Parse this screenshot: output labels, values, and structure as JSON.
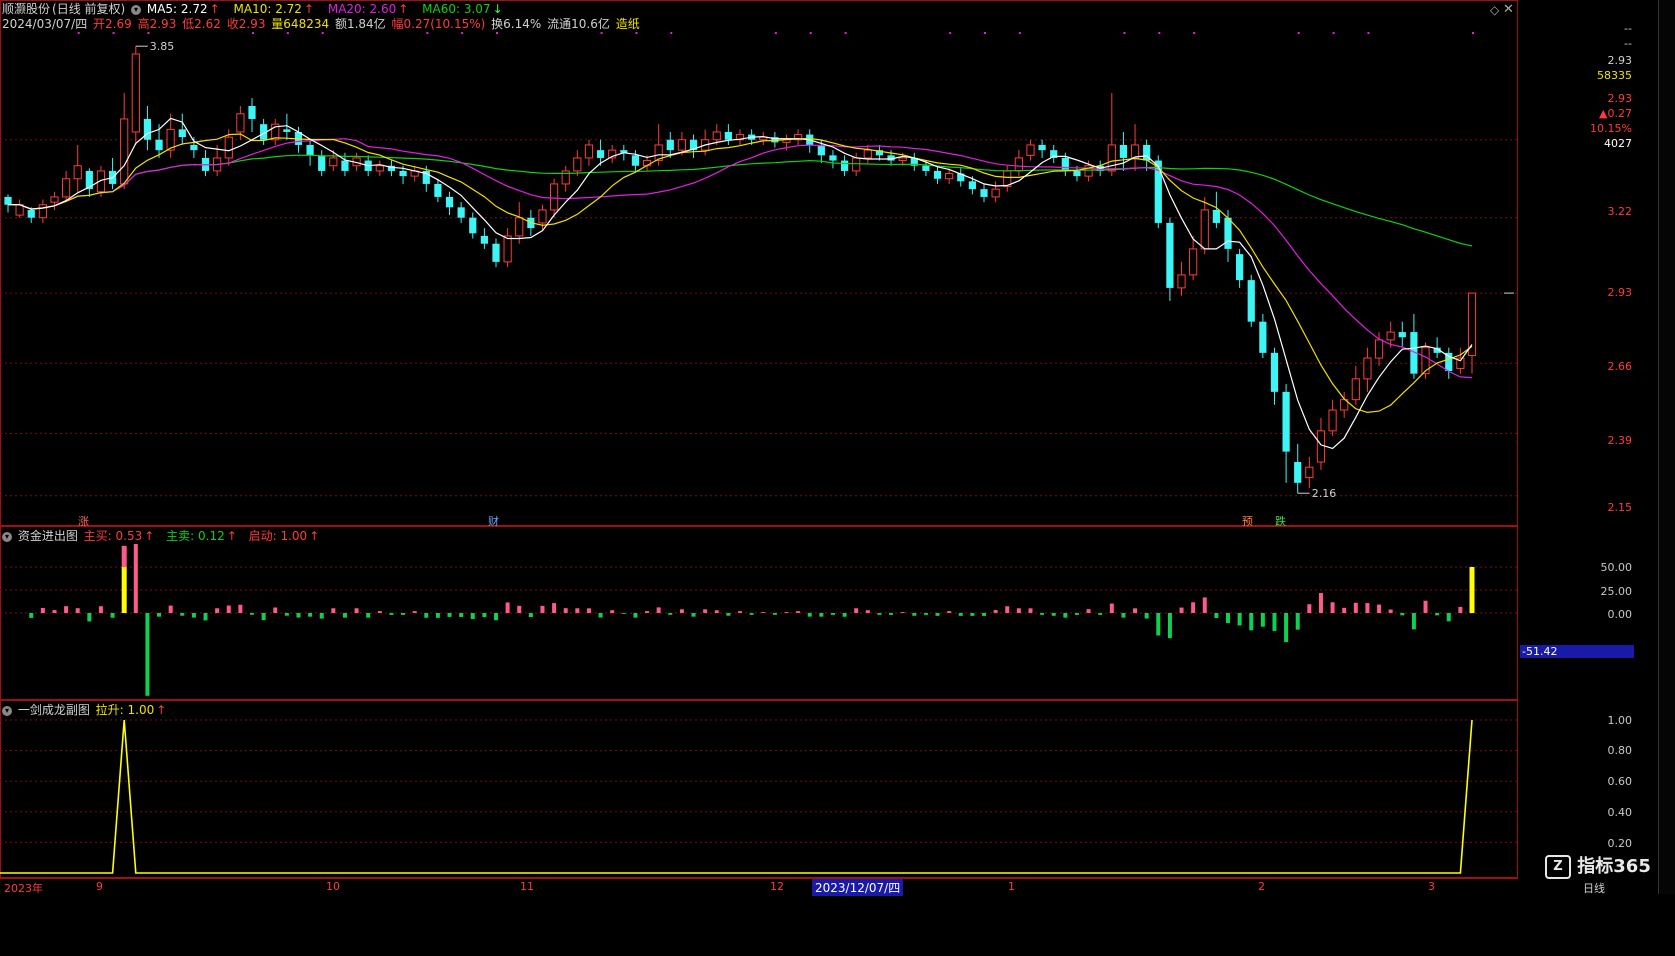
{
  "stock": {
    "name": "顺灏股份",
    "mode": "(日线 前复权)",
    "date": "2024/03/07/四",
    "ma5": "MA5: 2.72",
    "ma10": "MA10: 2.72",
    "ma20": "MA20: 2.60",
    "ma60": "MA60: 3.07",
    "open": "开2.69",
    "high": "高2.93",
    "low": "低2.62",
    "close": "收2.93",
    "volume": "量648234",
    "amount": "额1.84亿",
    "change": "幅0.27(10.15%)",
    "turnover": "换6.14%",
    "float": "流通10.6亿",
    "concept": "造纸",
    "max_label": "3.85",
    "min_label": "2.16"
  },
  "colors": {
    "up": "#ff3b3b",
    "down": "#3df5f5",
    "ma5": "#ffffff",
    "ma10": "#f0e000",
    "ma20": "#e020e0",
    "ma60": "#10d010",
    "grid": "#7a0f0f"
  },
  "right_axis": {
    "top_dash1": "--",
    "top_dash2": "--",
    "price": "2.93",
    "vol": "58335",
    "price2": "2.93",
    "chg": "▲0.27",
    "pct": "10.15%",
    "num": "4027",
    "ticks": [
      "3.22",
      "2.93",
      "2.66",
      "2.39",
      "2.15"
    ],
    "macd_ticks": [
      "50.00",
      "25.00",
      "0.00"
    ],
    "macd_value": "-51.42",
    "sub_ticks": [
      "1.00",
      "0.80",
      "0.60",
      "0.40",
      "0.20"
    ]
  },
  "markers": {
    "zhang": "涨",
    "cai": "财",
    "yu": "预",
    "die": "跌"
  },
  "panel2": {
    "title": "资金进出图",
    "buy": "主买: 0.53",
    "sell": "主卖: 0.12",
    "start": "启动: 1.00"
  },
  "panel3": {
    "title": "一剑成龙副图",
    "rise": "拉升: 1.00"
  },
  "time_axis": {
    "labels": [
      "2023年",
      "9",
      "10",
      "11",
      "12",
      "1",
      "2",
      "3"
    ],
    "cursor_date": "2023/12/07/四"
  },
  "brand": {
    "logo": "指标365",
    "period": "日线"
  },
  "chart_data": {
    "type": "candlestick",
    "ylim": [
      2.08,
      3.95
    ],
    "candles": [
      [
        3.3,
        3.27,
        3.31,
        3.24
      ],
      [
        3.23,
        3.27,
        3.29,
        3.22
      ],
      [
        3.25,
        3.22,
        3.26,
        3.2
      ],
      [
        3.22,
        3.27,
        3.29,
        3.2
      ],
      [
        3.28,
        3.3,
        3.32,
        3.25
      ],
      [
        3.3,
        3.37,
        3.4,
        3.28
      ],
      [
        3.37,
        3.42,
        3.5,
        3.32
      ],
      [
        3.4,
        3.33,
        3.41,
        3.3
      ],
      [
        3.32,
        3.4,
        3.42,
        3.3
      ],
      [
        3.4,
        3.35,
        3.45,
        3.33
      ],
      [
        3.35,
        3.6,
        3.7,
        3.33
      ],
      [
        3.55,
        3.85,
        3.88,
        3.5
      ],
      [
        3.6,
        3.52,
        3.65,
        3.48
      ],
      [
        3.52,
        3.48,
        3.58,
        3.45
      ],
      [
        3.48,
        3.56,
        3.62,
        3.45
      ],
      [
        3.56,
        3.53,
        3.62,
        3.5
      ],
      [
        3.5,
        3.48,
        3.53,
        3.45
      ],
      [
        3.45,
        3.4,
        3.48,
        3.38
      ],
      [
        3.4,
        3.45,
        3.5,
        3.38
      ],
      [
        3.45,
        3.53,
        3.56,
        3.42
      ],
      [
        3.55,
        3.62,
        3.65,
        3.52
      ],
      [
        3.65,
        3.6,
        3.68,
        3.55
      ],
      [
        3.58,
        3.52,
        3.6,
        3.5
      ],
      [
        3.52,
        3.58,
        3.6,
        3.5
      ],
      [
        3.56,
        3.55,
        3.62,
        3.52
      ],
      [
        3.55,
        3.5,
        3.57,
        3.47
      ],
      [
        3.5,
        3.46,
        3.52,
        3.42
      ],
      [
        3.46,
        3.4,
        3.48,
        3.38
      ],
      [
        3.42,
        3.45,
        3.48,
        3.4
      ],
      [
        3.44,
        3.4,
        3.47,
        3.38
      ],
      [
        3.42,
        3.45,
        3.47,
        3.4
      ],
      [
        3.44,
        3.4,
        3.46,
        3.38
      ],
      [
        3.4,
        3.42,
        3.44,
        3.38
      ],
      [
        3.42,
        3.4,
        3.44,
        3.38
      ],
      [
        3.4,
        3.38,
        3.42,
        3.35
      ],
      [
        3.38,
        3.4,
        3.42,
        3.36
      ],
      [
        3.4,
        3.35,
        3.42,
        3.32
      ],
      [
        3.35,
        3.3,
        3.37,
        3.28
      ],
      [
        3.3,
        3.26,
        3.32,
        3.23
      ],
      [
        3.26,
        3.22,
        3.28,
        3.2
      ],
      [
        3.22,
        3.16,
        3.24,
        3.14
      ],
      [
        3.15,
        3.12,
        3.18,
        3.1
      ],
      [
        3.12,
        3.05,
        3.14,
        3.03
      ],
      [
        3.05,
        3.15,
        3.18,
        3.03
      ],
      [
        3.15,
        3.22,
        3.28,
        3.12
      ],
      [
        3.22,
        3.18,
        3.25,
        3.15
      ],
      [
        3.2,
        3.25,
        3.27,
        3.17
      ],
      [
        3.25,
        3.35,
        3.37,
        3.22
      ],
      [
        3.35,
        3.4,
        3.42,
        3.32
      ],
      [
        3.4,
        3.45,
        3.48,
        3.38
      ],
      [
        3.45,
        3.5,
        3.52,
        3.42
      ],
      [
        3.48,
        3.45,
        3.52,
        3.42
      ],
      [
        3.45,
        3.48,
        3.5,
        3.43
      ],
      [
        3.48,
        3.47,
        3.5,
        3.44
      ],
      [
        3.46,
        3.42,
        3.48,
        3.4
      ],
      [
        3.42,
        3.44,
        3.46,
        3.4
      ],
      [
        3.44,
        3.5,
        3.58,
        3.42
      ],
      [
        3.52,
        3.48,
        3.55,
        3.45
      ],
      [
        3.48,
        3.52,
        3.55,
        3.46
      ],
      [
        3.52,
        3.48,
        3.54,
        3.45
      ],
      [
        3.48,
        3.52,
        3.56,
        3.46
      ],
      [
        3.52,
        3.55,
        3.58,
        3.5
      ],
      [
        3.55,
        3.52,
        3.58,
        3.5
      ],
      [
        3.52,
        3.54,
        3.56,
        3.5
      ],
      [
        3.54,
        3.52,
        3.56,
        3.5
      ],
      [
        3.52,
        3.53,
        3.55,
        3.5
      ],
      [
        3.53,
        3.51,
        3.55,
        3.49
      ],
      [
        3.51,
        3.52,
        3.54,
        3.48
      ],
      [
        3.52,
        3.54,
        3.56,
        3.5
      ],
      [
        3.54,
        3.5,
        3.56,
        3.47
      ],
      [
        3.5,
        3.46,
        3.52,
        3.43
      ],
      [
        3.46,
        3.44,
        3.48,
        3.41
      ],
      [
        3.44,
        3.4,
        3.46,
        3.38
      ],
      [
        3.4,
        3.45,
        3.47,
        3.38
      ],
      [
        3.45,
        3.48,
        3.5,
        3.43
      ],
      [
        3.48,
        3.46,
        3.5,
        3.44
      ],
      [
        3.46,
        3.44,
        3.48,
        3.42
      ],
      [
        3.44,
        3.45,
        3.47,
        3.42
      ],
      [
        3.45,
        3.42,
        3.47,
        3.4
      ],
      [
        3.42,
        3.4,
        3.44,
        3.38
      ],
      [
        3.4,
        3.37,
        3.42,
        3.35
      ],
      [
        3.37,
        3.39,
        3.41,
        3.35
      ],
      [
        3.39,
        3.36,
        3.41,
        3.34
      ],
      [
        3.36,
        3.33,
        3.38,
        3.31
      ],
      [
        3.33,
        3.3,
        3.35,
        3.28
      ],
      [
        3.3,
        3.33,
        3.36,
        3.28
      ],
      [
        3.34,
        3.4,
        3.42,
        3.32
      ],
      [
        3.4,
        3.45,
        3.48,
        3.38
      ],
      [
        3.46,
        3.5,
        3.52,
        3.44
      ],
      [
        3.5,
        3.48,
        3.52,
        3.45
      ],
      [
        3.48,
        3.45,
        3.5,
        3.43
      ],
      [
        3.45,
        3.4,
        3.47,
        3.38
      ],
      [
        3.4,
        3.38,
        3.42,
        3.36
      ],
      [
        3.38,
        3.42,
        3.44,
        3.36
      ],
      [
        3.42,
        3.4,
        3.44,
        3.38
      ],
      [
        3.4,
        3.5,
        3.7,
        3.38
      ],
      [
        3.5,
        3.45,
        3.55,
        3.4
      ],
      [
        3.45,
        3.5,
        3.58,
        3.4
      ],
      [
        3.5,
        3.44,
        3.52,
        3.4
      ],
      [
        3.44,
        3.2,
        3.46,
        3.18
      ],
      [
        3.2,
        2.95,
        3.22,
        2.9
      ],
      [
        2.95,
        3.0,
        3.05,
        2.92
      ],
      [
        3.0,
        3.1,
        3.15,
        2.98
      ],
      [
        3.1,
        3.25,
        3.3,
        3.08
      ],
      [
        3.25,
        3.2,
        3.32,
        3.18
      ],
      [
        3.22,
        3.1,
        3.25,
        3.05
      ],
      [
        3.08,
        2.98,
        3.1,
        2.95
      ],
      [
        2.98,
        2.82,
        3.0,
        2.8
      ],
      [
        2.82,
        2.7,
        2.85,
        2.68
      ],
      [
        2.7,
        2.55,
        2.72,
        2.5
      ],
      [
        2.55,
        2.32,
        2.58,
        2.2
      ],
      [
        2.28,
        2.2,
        2.35,
        2.16
      ],
      [
        2.22,
        2.26,
        2.3,
        2.18
      ],
      [
        2.28,
        2.4,
        2.45,
        2.25
      ],
      [
        2.4,
        2.48,
        2.52,
        2.38
      ],
      [
        2.48,
        2.52,
        2.55,
        2.45
      ],
      [
        2.52,
        2.6,
        2.65,
        2.5
      ],
      [
        2.6,
        2.68,
        2.72,
        2.55
      ],
      [
        2.68,
        2.75,
        2.78,
        2.65
      ],
      [
        2.75,
        2.78,
        2.82,
        2.72
      ],
      [
        2.78,
        2.76,
        2.82,
        2.72
      ],
      [
        2.78,
        2.62,
        2.85,
        2.6
      ],
      [
        2.62,
        2.72,
        2.74,
        2.6
      ],
      [
        2.72,
        2.7,
        2.76,
        2.68
      ],
      [
        2.7,
        2.63,
        2.72,
        2.6
      ],
      [
        2.64,
        2.68,
        2.72,
        2.62
      ],
      [
        2.69,
        2.93,
        2.93,
        2.62
      ]
    ]
  }
}
